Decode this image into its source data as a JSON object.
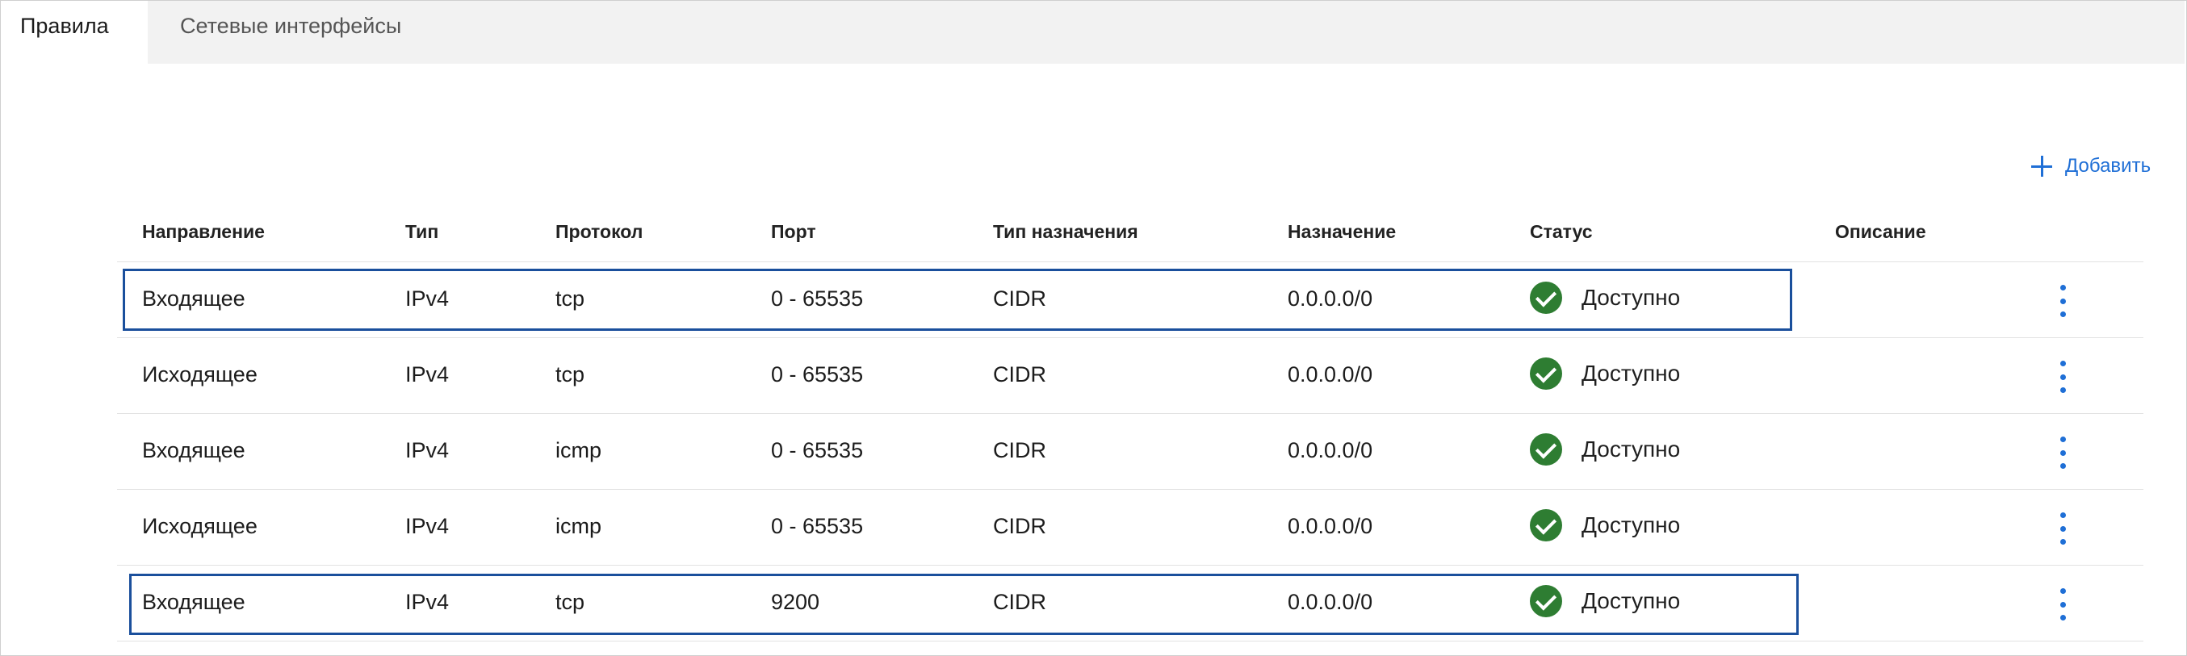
{
  "tabs": [
    {
      "label": "Правила",
      "active": true
    },
    {
      "label": "Сетевые интерфейсы",
      "active": false
    }
  ],
  "toolbar": {
    "add_label": "Добавить",
    "add_icon": "plus-icon"
  },
  "table": {
    "headers": {
      "direction": "Направление",
      "type": "Тип",
      "protocol": "Протокол",
      "port": "Порт",
      "dest_type": "Тип назначения",
      "destination": "Назначение",
      "status": "Статус",
      "description": "Описание"
    },
    "rows": [
      {
        "direction": "Входящее",
        "type": "IPv4",
        "protocol": "tcp",
        "port": "0 - 65535",
        "dest_type": "CIDR",
        "destination": "0.0.0.0/0",
        "status": "Доступно",
        "description": "",
        "highlighted": true
      },
      {
        "direction": "Исходящее",
        "type": "IPv4",
        "protocol": "tcp",
        "port": "0 - 65535",
        "dest_type": "CIDR",
        "destination": "0.0.0.0/0",
        "status": "Доступно",
        "description": "",
        "highlighted": false
      },
      {
        "direction": "Входящее",
        "type": "IPv4",
        "protocol": "icmp",
        "port": "0 - 65535",
        "dest_type": "CIDR",
        "destination": "0.0.0.0/0",
        "status": "Доступно",
        "description": "",
        "highlighted": false
      },
      {
        "direction": "Исходящее",
        "type": "IPv4",
        "protocol": "icmp",
        "port": "0 - 65535",
        "dest_type": "CIDR",
        "destination": "0.0.0.0/0",
        "status": "Доступно",
        "description": "",
        "highlighted": false
      },
      {
        "direction": "Входящее",
        "type": "IPv4",
        "protocol": "tcp",
        "port": "9200",
        "dest_type": "CIDR",
        "destination": "0.0.0.0/0",
        "status": "Доступно",
        "description": "",
        "highlighted": true
      }
    ]
  },
  "colors": {
    "accent": "#1f6fd6",
    "status_ok": "#2e7d32",
    "highlight_border": "#1a4f9c"
  }
}
